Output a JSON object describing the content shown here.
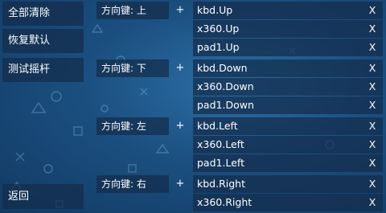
{
  "left_menu": {
    "clear_all": "全部清除",
    "restore_default": "恢复默认",
    "test_joystick": "测试摇杆",
    "back": "返回"
  },
  "mappings": [
    {
      "direction": "方向键: 上",
      "add": "+",
      "bindings": [
        {
          "label": "kbd.Up",
          "remove": "X"
        },
        {
          "label": "x360.Up",
          "remove": "X"
        },
        {
          "label": "pad1.Up",
          "remove": "X"
        }
      ]
    },
    {
      "direction": "方向键: 下",
      "add": "+",
      "bindings": [
        {
          "label": "kbd.Down",
          "remove": "X"
        },
        {
          "label": "x360.Down",
          "remove": "X"
        },
        {
          "label": "pad1.Down",
          "remove": "X"
        }
      ]
    },
    {
      "direction": "方向键: 左",
      "add": "+",
      "bindings": [
        {
          "label": "kbd.Left",
          "remove": "X"
        },
        {
          "label": "x360.Left",
          "remove": "X"
        },
        {
          "label": "pad1.Left",
          "remove": "X"
        }
      ]
    },
    {
      "direction": "方向键: 右",
      "add": "+",
      "bindings": [
        {
          "label": "kbd.Right",
          "remove": "X"
        },
        {
          "label": "x360.Right",
          "remove": "X"
        }
      ]
    }
  ],
  "colors": {
    "background": "#1b4f80",
    "panel": "#142d4b",
    "text": "#ffffff"
  }
}
